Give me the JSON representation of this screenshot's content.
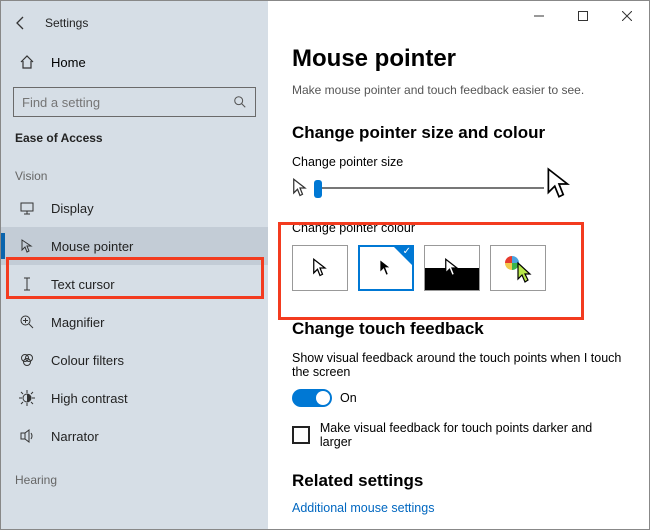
{
  "app_title": "Settings",
  "home_label": "Home",
  "search_placeholder": "Find a setting",
  "section": "Ease of Access",
  "group_vision": "Vision",
  "group_hearing": "Hearing",
  "nav": {
    "display": "Display",
    "mouse_pointer": "Mouse pointer",
    "text_cursor": "Text cursor",
    "magnifier": "Magnifier",
    "colour_filters": "Colour filters",
    "high_contrast": "High contrast",
    "narrator": "Narrator"
  },
  "main": {
    "title": "Mouse pointer",
    "subtitle": "Make mouse pointer and touch feedback easier to see.",
    "h_size_colour": "Change pointer size and colour",
    "label_size": "Change pointer size",
    "label_colour": "Change pointer colour",
    "h_touch": "Change touch feedback",
    "touch_desc": "Show visual feedback around the touch points when I touch the screen",
    "toggle_label": "On",
    "check_label": "Make visual feedback for touch points darker and larger",
    "h_related": "Related settings",
    "link_additional": "Additional mouse settings"
  }
}
